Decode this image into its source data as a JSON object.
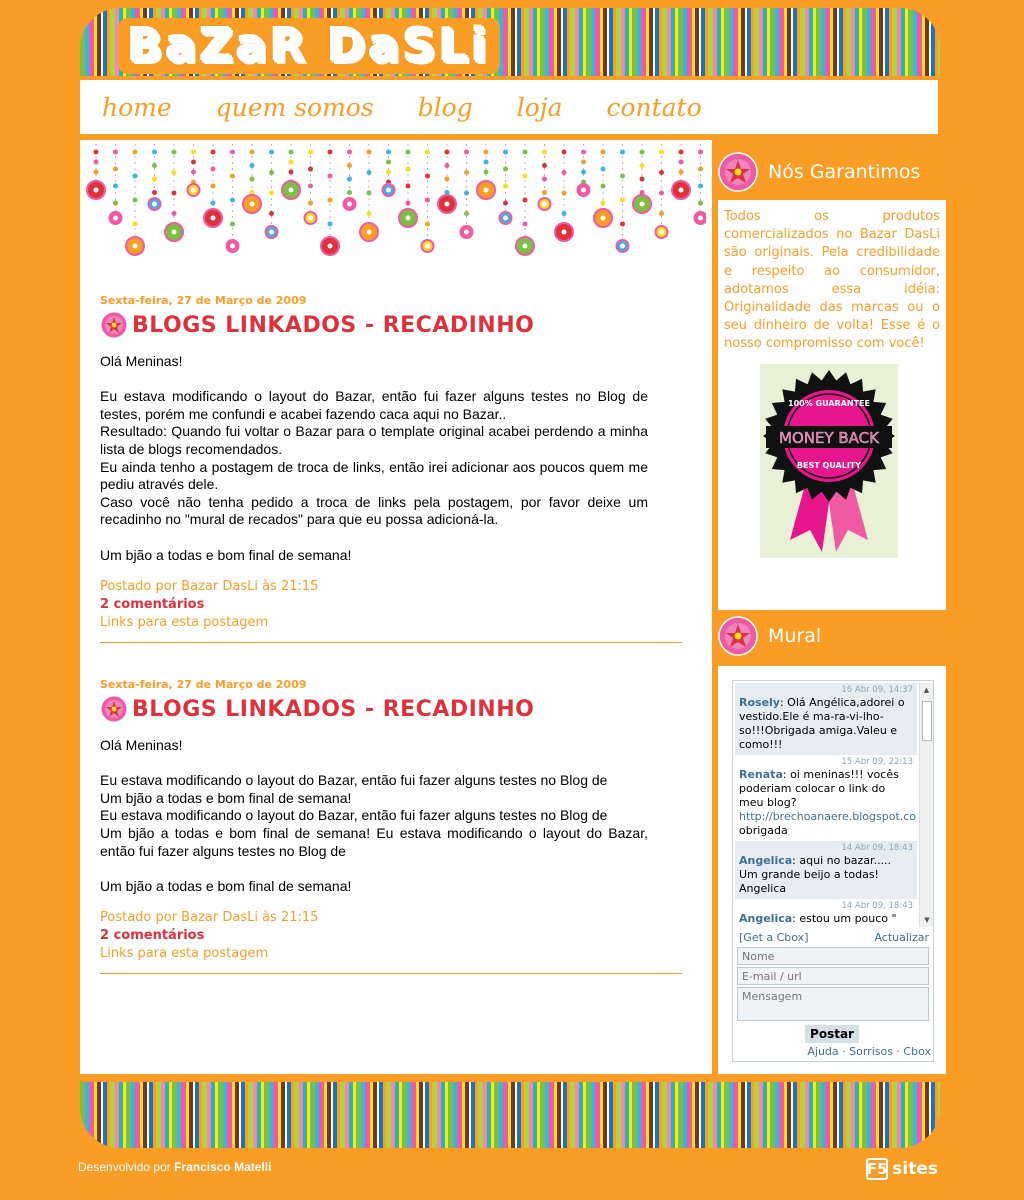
{
  "header": {
    "logo_text": "BaZaR DaSLi"
  },
  "nav": {
    "items": [
      "home",
      "quem somos",
      "blog",
      "loja",
      "contato"
    ]
  },
  "posts": [
    {
      "date": "Sexta-feira, 27 de Março de 2009",
      "title": "BLOGS LINKADOS - RECADINHO",
      "body": [
        "Olá Meninas!",
        "",
        "Eu estava modificando o layout do Bazar, então fui fazer alguns testes no Blog de testes, porém me confundi e acabei fazendo caca aqui no Bazar..",
        "Resultado: Quando fui voltar o Bazar para o template original acabei perdendo a minha lista de blogs recomendados.",
        "Eu ainda tenho a postagem de troca de links, então irei adicionar aos poucos quem me pediu através dele.",
        "Caso você não tenha pedido a troca de links pela postagem, por favor deixe um recadinho no \"mural de recados\" para que eu possa adicioná-la.",
        "",
        "Um bjão a todas e bom final de semana!"
      ],
      "posted_by": "Postado por Bazar DasLi às 21:15",
      "comments": "2 comentários",
      "links": "Links para esta postagem"
    },
    {
      "date": "Sexta-feira, 27 de Março de 2009",
      "title": "BLOGS LINKADOS - RECADINHO",
      "body": [
        "Olá Meninas!",
        "",
        "Eu estava modificando o layout do Bazar, então fui fazer alguns testes no Blog de",
        "Um bjão a todas e bom final de semana!",
        "Eu estava modificando o layout do Bazar, então fui fazer alguns testes no Blog de",
        "Um bjão a todas e bom final de semana! Eu estava modificando o layout do Bazar, então fui fazer alguns testes no Blog de",
        "",
        "Um bjão a todas e bom final de semana!"
      ],
      "posted_by": "Postado por Bazar DasLi às 21:15",
      "comments": "2 comentários",
      "links": "Links para esta postagem"
    }
  ],
  "sidebar": {
    "garantimos": {
      "title": "Nós Garantimos",
      "text": "Todos os produtos comercializados no Bazar DasLi são originais. Pela credibilidade e respeito ao consumidor, adotamos essa idéia: Originalidade das marcas ou o seu dinheiro de volta! Esse é o nosso compromisso com você!",
      "badge": {
        "top": "100% GUARANTEE",
        "main": "MONEY BACK",
        "bottom": "BEST QUALITY"
      }
    },
    "mural": {
      "title": "Mural",
      "messages": [
        {
          "time": "16 Abr 09, 14:37",
          "name": "Rosely",
          "text": ": Olá Angélica,adorei o vestido.Ele é ma-ra-vi-lho-so!!!Obrigada amiga.Valeu e como!!!",
          "url": ""
        },
        {
          "time": "15 Abr 09, 22:13",
          "name": "Renata",
          "text": ": oi meninas!!! vocês poderiam colocar o link do meu blog?",
          "url": "http://brechoanaere.blogspot.com",
          "after": "obrigada"
        },
        {
          "time": "14 Abr 09, 18:43",
          "name": "Angelica",
          "text": ": aqui no bazar..... Um grande beijo a todas! Angelica",
          "url": ""
        },
        {
          "time": "14 Abr 09, 18:43",
          "name": "Angelica",
          "text": ": estou um pouco \" FORA DO AR\" porque estou",
          "url": ""
        }
      ],
      "get_cbox": "[Get a Cbox]",
      "refresh": "Actualizar",
      "name_placeholder": "Nome",
      "email_placeholder": "E-mail / url",
      "message_placeholder": "Mensagem",
      "post_button": "Postar",
      "bottom_links": "Ajuda · Sorrisos · Cbox"
    }
  },
  "footer": {
    "credit_prefix": "Desenvolvido por",
    "credit_name": "Francisco Matelli",
    "badge_box": "F5",
    "badge_text": "sites"
  },
  "colors": {
    "orange": "#F99D25",
    "red": "#E0313A",
    "pink": "#F05AA3"
  }
}
